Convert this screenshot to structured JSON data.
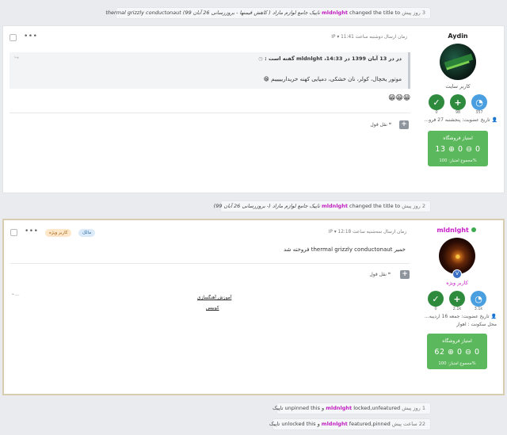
{
  "events": [
    {
      "when": "3 روز پیش",
      "user": "mldnlght",
      "action": "changed the title to",
      "text": "تاپیک جامع لوازم مازاد ( کاهش قیمتها - بروزرسانی 26 آبان 99) thermal grizzly conductonaut"
    },
    {
      "when": "2 روز پیش",
      "user": "mldnlght",
      "action": "changed the title to",
      "text": "تاپیک جامع لوازم مازاد (- بروزرسانی 26 آبان 99)"
    },
    {
      "when": "1 روز پیش",
      "user": "mldnlght",
      "action": "locked,unfeatured",
      "text": "و unpinned this تاپیک"
    },
    {
      "when": "22 ساعت پیش",
      "user": "mldnlght",
      "action": "featured,pinned",
      "text": "و unlocked this تاپیک"
    }
  ],
  "post1": {
    "username": "Aydin",
    "user_title": "کاربر سایت",
    "stats": [
      {
        "value": "0"
      },
      {
        "value": "98"
      },
      {
        "value": "357"
      }
    ],
    "member_since": "تاریخ عضویت: پنجشنبه 27 فرو...",
    "trust": {
      "title": "امتیاز فروشگاه",
      "values": "13 ⊕ 0 ⊖ 0",
      "total": "مجموع امتیاز: 100%"
    },
    "date": "زمان ارسال دوشنبه ساعت 11:41",
    "ip": "IP",
    "quote_header": "در در 13 آبان 1399 در 14:33، mldnlght گفته است :",
    "quote_body": "موتور یخچال، کولر، نان خشکی، دمپایی کهنه خریداریییییم 😁",
    "emojis": "😁😁😁",
    "quote_action": "نقل قول"
  },
  "post2": {
    "username": "mldnlght",
    "user_title": "کاربر ویژه",
    "stats": [
      {
        "value": "0"
      },
      {
        "value": "2.1k"
      },
      {
        "value": "3.1k"
      }
    ],
    "member_since": "تاریخ عضویت: جمعه 16 اردیبه...",
    "location": "محل سکونت : اهواز",
    "trust": {
      "title": "امتیاز فروشگاه",
      "values": "62 ⊕ 0 ⊖ 0",
      "total": "مجموع امتیاز: 100%"
    },
    "date": "زمان ارسال سه‌شنبه ساعت 12:18",
    "ip": "IP",
    "badge_owner": "مالک",
    "badge_vip": "کاربر ویژه",
    "body": "خمیر thermal grizzly conductonaut فروخته شد",
    "quote_action": "نقل قول",
    "signature": [
      "آموزش آهنگسازی",
      "کوبیس"
    ]
  }
}
